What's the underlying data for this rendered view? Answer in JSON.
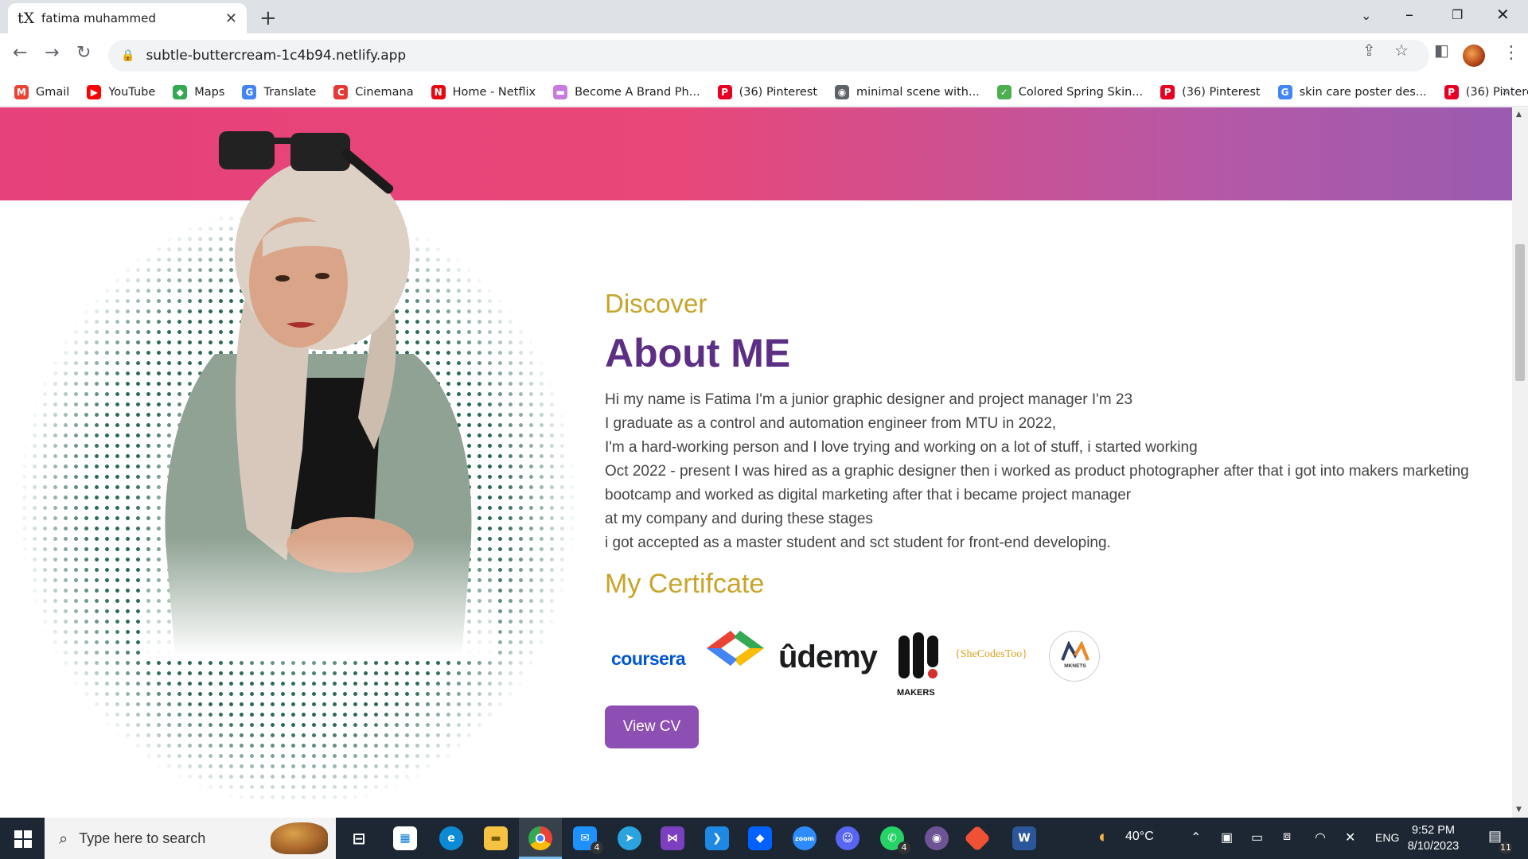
{
  "browser": {
    "tab_title": "fatima muhammed",
    "tab_favicon": "tX",
    "url": "subtle-buttercream-1c4b94.netlify.app"
  },
  "bookmarks": [
    {
      "label": "Gmail",
      "icon": "gmail-icon",
      "color": "#ea4335",
      "glyph": "M"
    },
    {
      "label": "YouTube",
      "icon": "youtube-icon",
      "color": "#ff0000",
      "glyph": "▶"
    },
    {
      "label": "Maps",
      "icon": "maps-icon",
      "color": "#34a853",
      "glyph": "◆"
    },
    {
      "label": "Translate",
      "icon": "translate-icon",
      "color": "#4285f4",
      "glyph": "G"
    },
    {
      "label": "Cinemana",
      "icon": "cinemana-icon",
      "color": "#e53935",
      "glyph": "C"
    },
    {
      "label": "Home - Netflix",
      "icon": "netflix-icon",
      "color": "#e50914",
      "glyph": "N"
    },
    {
      "label": "Become A Brand Ph...",
      "icon": "brand-icon",
      "color": "#c77dde",
      "glyph": "▬"
    },
    {
      "label": "(36) Pinterest",
      "icon": "pinterest-icon",
      "color": "#e60023",
      "glyph": "P"
    },
    {
      "label": "minimal scene with...",
      "icon": "globe-icon",
      "color": "#5f6368",
      "glyph": "◉"
    },
    {
      "label": "Colored Spring Skin...",
      "icon": "spring-icon",
      "color": "#4caf50",
      "glyph": "✓"
    },
    {
      "label": "(36) Pinterest",
      "icon": "pinterest-icon",
      "color": "#e60023",
      "glyph": "P"
    },
    {
      "label": "skin care poster des...",
      "icon": "google-icon",
      "color": "#4285f4",
      "glyph": "G"
    },
    {
      "label": "(36) Pinterest",
      "icon": "pinterest-icon",
      "color": "#e60023",
      "glyph": "P"
    }
  ],
  "about": {
    "kicker": "Discover",
    "title": "About ME",
    "bio_lines": [
      "Hi my name is Fatima I'm a junior graphic designer and project manager I'm 23",
      "I graduate as a control and automation engineer from MTU in 2022,",
      "I'm a hard-working person and I love trying and working on a lot of stuff, i started working",
      "Oct 2022 - present I was hired as a graphic designer then i worked as product photographer after that i got into makers marketing",
      "bootcamp and worked as digital marketing after that i became project manager",
      "at my company and during these stages",
      "i got accepted as a master student and sct student for front-end developing."
    ],
    "cert_title": "My Certifcate",
    "certificates": {
      "coursera": "coursera",
      "udemy": "ûdemy",
      "makers": "MAKERS",
      "shecodes": "{SheCodesToo}",
      "mknets": "MKNETS"
    },
    "cv_button": "View CV"
  },
  "colors": {
    "accent_purple": "#8e4fb5",
    "gold": "#c7a42a",
    "title_purple": "#5d2f84",
    "banner_pink": "#e6417a"
  },
  "taskbar": {
    "search_placeholder": "Type here to search",
    "mail_badge": "4",
    "whatsapp_badge": "4",
    "temperature": "40°C",
    "language": "ENG",
    "time": "9:52 PM",
    "date": "8/10/2023",
    "notifications": "11"
  }
}
